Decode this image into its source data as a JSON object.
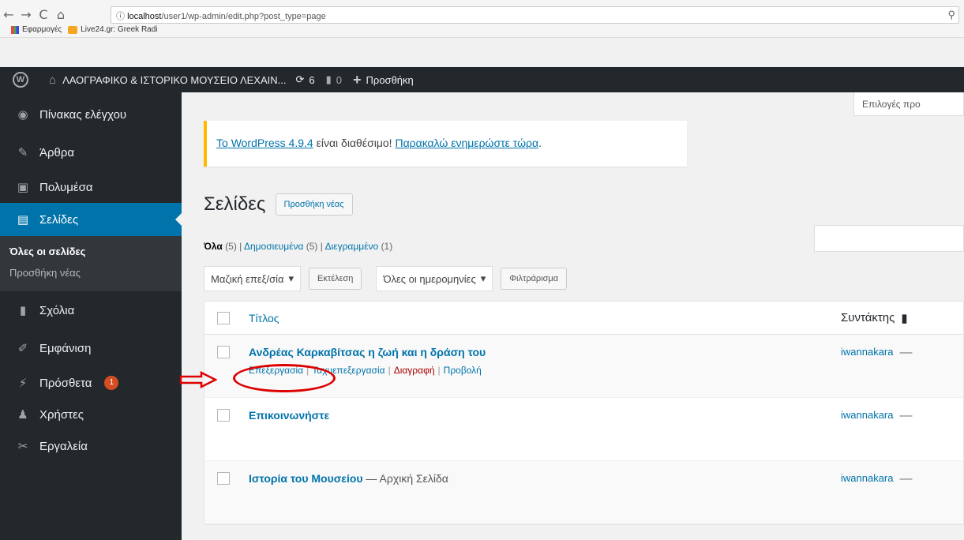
{
  "browser": {
    "nav": {
      "back": "←",
      "forward": "→",
      "reload": "C",
      "home": "⌂"
    },
    "url_host": "localhost",
    "url_path": "/user1/wp-admin/edit.php?post_type=page",
    "bookmarks": [
      {
        "label": "Εφαρμογές"
      },
      {
        "label": "Live24.gr: Greek Radi"
      }
    ]
  },
  "adminbar": {
    "site_name": "ΛΑΟΓΡΑΦΙΚΟ & ΙΣΤΟΡΙΚΟ ΜΟΥΣΕΙΟ ΛΕΧΑΙΝ...",
    "updates_count": "6",
    "comments_count": "0",
    "new_label": "Προσθήκη"
  },
  "sidebar": {
    "items": [
      {
        "label": "Πίνακας ελέγχου",
        "icon": "dashboard-icon"
      },
      {
        "label": "Άρθρα",
        "icon": "pin-icon"
      },
      {
        "label": "Πολυμέσα",
        "icon": "media-icon"
      },
      {
        "label": "Σελίδες",
        "icon": "pages-icon"
      },
      {
        "label": "Σχόλια",
        "icon": "comments-icon"
      },
      {
        "label": "Εμφάνιση",
        "icon": "appearance-icon"
      },
      {
        "label": "Πρόσθετα",
        "icon": "plugins-icon",
        "badge": "1"
      },
      {
        "label": "Χρήστες",
        "icon": "users-icon"
      },
      {
        "label": "Εργαλεία",
        "icon": "tools-icon"
      }
    ],
    "submenu": {
      "all_pages": "Όλες οι σελίδες",
      "add_new": "Προσθήκη νέας"
    }
  },
  "main": {
    "screen_options": "Επιλογές προ",
    "notice": {
      "link1": "Το WordPress 4.9.4",
      "text": " είναι διαθέσιμο! ",
      "link2": "Παρακαλώ ενημερώστε τώρα",
      "end": "."
    },
    "heading": "Σελίδες",
    "add_new": "Προσθήκη νέας",
    "filters": {
      "all": "Όλα",
      "all_count": "(5)",
      "published": "Δημοσιευμένα",
      "published_count": "(5)",
      "trash": "Διεγραμμένο",
      "trash_count": "(1)"
    },
    "bulk_select": "Μαζική επεξ/σία",
    "apply": "Εκτέλεση",
    "dates_select": "Όλες οι ημερομηνίες",
    "filter_btn": "Φιλτράρισμα",
    "columns": {
      "title": "Τίτλος",
      "author": "Συντάκτης"
    },
    "rows": [
      {
        "title": "Ανδρέας Καρκαβίτσας η ζωή και η δράση του",
        "author": "iwannakara",
        "dash": "—"
      },
      {
        "title": "Επικοινωνήστε",
        "author": "iwannakara",
        "dash": "—"
      },
      {
        "title": "Ιστορία του Μουσείου",
        "state": " — Αρχική Σελίδα",
        "author": "iwannakara",
        "dash": "—"
      }
    ],
    "row_actions": {
      "edit": "Επεξεργασία",
      "quick_edit": "Ταχυεπεξεργασία",
      "trash": "Διαγραφή",
      "view": "Προβολή",
      "sep": "|"
    }
  },
  "colors": {
    "adminbar": "#23282d",
    "active": "#0073aa",
    "notice": "#ffb900",
    "annotation": "#dd0000"
  }
}
